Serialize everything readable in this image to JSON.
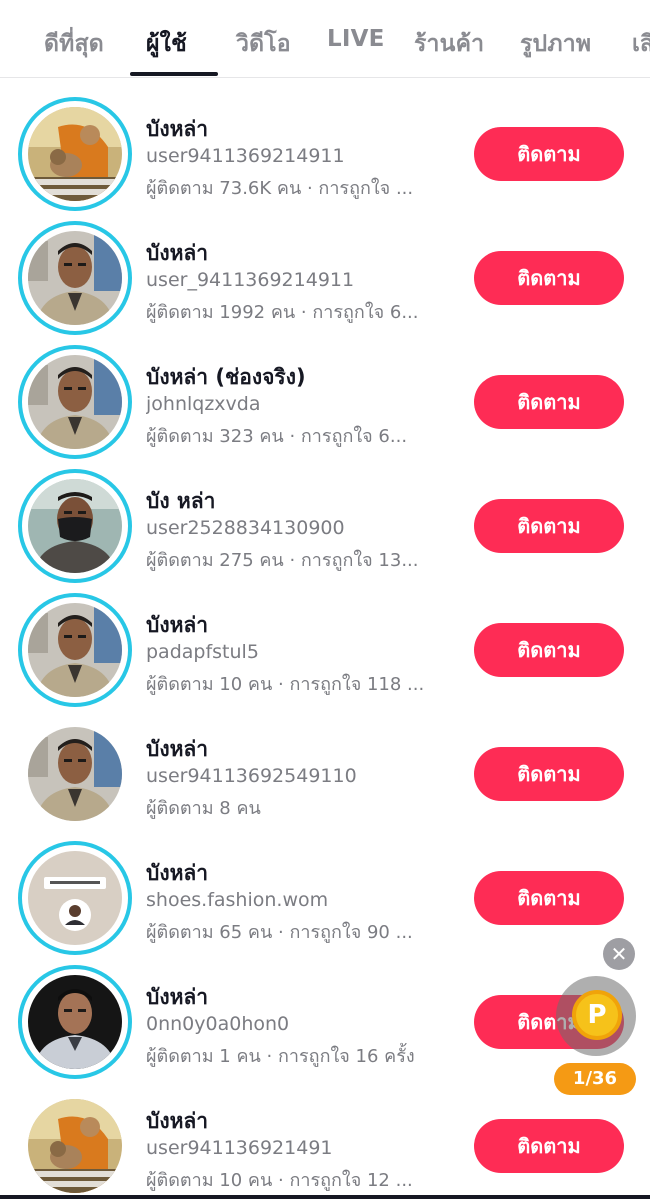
{
  "tabs": [
    {
      "label": "ดีที่สุด",
      "active": false
    },
    {
      "label": "ผู้ใช้",
      "active": true
    },
    {
      "label": "วิดีโอ",
      "active": false
    },
    {
      "label": "LIVE",
      "active": false
    },
    {
      "label": "ร้านค้า",
      "active": false
    },
    {
      "label": "รูปภาพ",
      "active": false
    },
    {
      "label": "เสี",
      "active": false
    }
  ],
  "follow_label": "ติดตาม",
  "users": [
    {
      "name": "บังหล่า",
      "handle": "user9411369214911",
      "stats": "ผู้ติดตาม 73.6K คน · การถูกใจ ...",
      "avatar": "monk-dog-icon",
      "ring": true
    },
    {
      "name": "บังหล่า",
      "handle": "user_9411369214911",
      "stats": "ผู้ติดตาม 1992 คน · การถูกใจ 6...",
      "avatar": "man-uniform-icon",
      "ring": true
    },
    {
      "name": "บังหล่า (ช่องจริง)",
      "handle": "johnlqzxvda",
      "stats": "ผู้ติดตาม 323 คน · การถูกใจ 6...",
      "avatar": "man-uniform-icon",
      "ring": true
    },
    {
      "name": "บัง หล่า",
      "handle": "user2528834130900",
      "stats": "ผู้ติดตาม 275 คน · การถูกใจ 13...",
      "avatar": "man-mask-icon",
      "ring": true
    },
    {
      "name": "บังหล่า",
      "handle": "padapfstul5",
      "stats": "ผู้ติดตาม 10 คน · การถูกใจ 118 ...",
      "avatar": "man-uniform-icon",
      "ring": true
    },
    {
      "name": "บังหล่า",
      "handle": "user94113692549110",
      "stats": "ผู้ติดตาม 8 คน",
      "avatar": "man-uniform-icon",
      "ring": false
    },
    {
      "name": "บังหล่า",
      "handle": "shoes.fashion.wom",
      "stats": "ผู้ติดตาม 65 คน · การถูกใจ 90 ...",
      "avatar": "photo-card-icon",
      "ring": true
    },
    {
      "name": "บังหล่า",
      "handle": "0nn0y0a0hon0",
      "stats": "ผู้ติดตาม 1 คน · การถูกใจ 16 ครั้ง",
      "avatar": "man-dark-bg-icon",
      "ring": true
    },
    {
      "name": "บังหล่า",
      "handle": "user941136921491",
      "stats": "ผู้ติดตาม 10 คน · การถูกใจ 12 ...",
      "avatar": "monk-dog-icon",
      "ring": false
    }
  ],
  "floating_widget": {
    "close_icon": "close-icon",
    "coin_icon": "coin-p-icon",
    "coin_letter": "P",
    "counter": "1/36"
  }
}
